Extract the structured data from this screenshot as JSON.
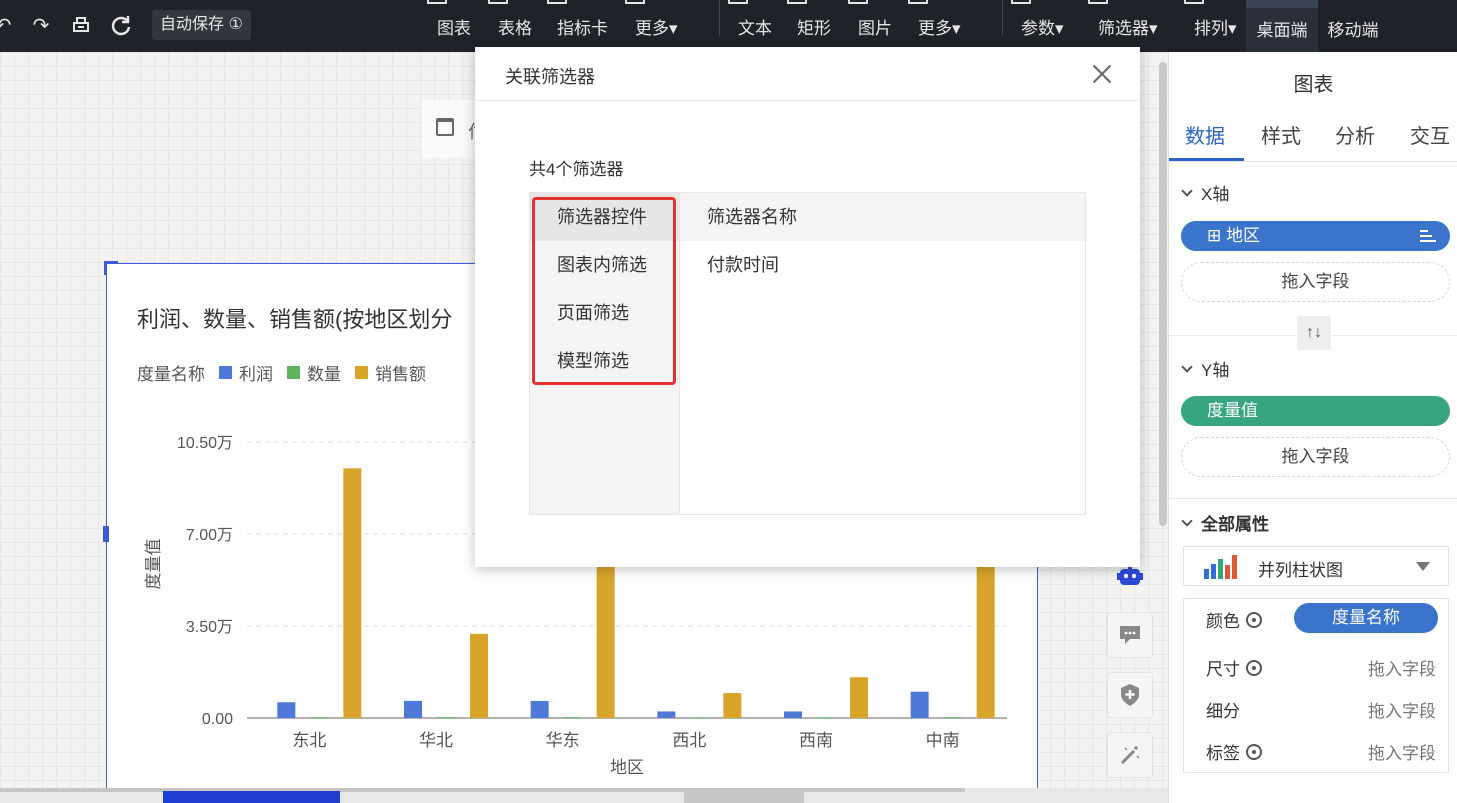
{
  "toolbar": {
    "autosave": "自动保存 ①",
    "insert_group": [
      "图表",
      "表格",
      "指标卡",
      "更多▾"
    ],
    "element_group": [
      "文本",
      "矩形",
      "图片",
      "更多▾"
    ],
    "control_group": [
      "参数▾",
      "筛选器▾",
      "排列▾"
    ],
    "devices": [
      "桌面端",
      "移动端"
    ]
  },
  "date_widget": {
    "text_fragment": "付"
  },
  "chart": {
    "title": "利润、数量、销售额(按地区划分",
    "legend_title": "度量名称"
  },
  "chart_data": {
    "type": "bar",
    "categories": [
      "东北",
      "华北",
      "华东",
      "西北",
      "西南",
      "中南"
    ],
    "series": [
      {
        "name": "利润",
        "color": "#4e79d9",
        "values": [
          6000,
          6500,
          6500,
          2500,
          2500,
          10000
        ]
      },
      {
        "name": "数量",
        "color": "#5fb35f",
        "values": [
          300,
          300,
          300,
          200,
          200,
          300
        ]
      },
      {
        "name": "销售额",
        "color": "#d8a52a",
        "values": [
          95000,
          32000,
          82000,
          9500,
          15500,
          80000
        ]
      }
    ],
    "yticks": [
      "0.00",
      "3.50万",
      "7.00万",
      "10.50万"
    ],
    "ytick_values": [
      0,
      35000,
      70000,
      105000
    ],
    "ylim": [
      0,
      105000
    ],
    "xlabel": "地区",
    "ylabel": "度量值"
  },
  "right_panel": {
    "title": "图表",
    "tabs": [
      "数据",
      "样式",
      "分析",
      "交互"
    ],
    "x_axis": {
      "label": "X轴",
      "field": "⊞ 地区",
      "dropzone": "拖入字段"
    },
    "y_axis": {
      "label": "Y轴",
      "field": "度量值",
      "dropzone": "拖入字段"
    },
    "swap": "↑↓",
    "all_props": "全部属性",
    "chart_type": "并列柱状图",
    "attrs": [
      {
        "label": "颜色",
        "value": "度量名称",
        "gear": true
      },
      {
        "label": "尺寸",
        "value": "拖入字段",
        "gear": true
      },
      {
        "label": "细分",
        "value": "拖入字段",
        "gear": false
      },
      {
        "label": "标签",
        "value": "拖入字段",
        "gear": true
      }
    ]
  },
  "modal": {
    "title": "关联筛选器",
    "count": "共4个筛选器",
    "left_items": [
      "筛选器控件",
      "图表内筛选",
      "页面筛选",
      "模型筛选"
    ],
    "right_header": "筛选器名称",
    "right_rows": [
      "付款时间"
    ]
  }
}
